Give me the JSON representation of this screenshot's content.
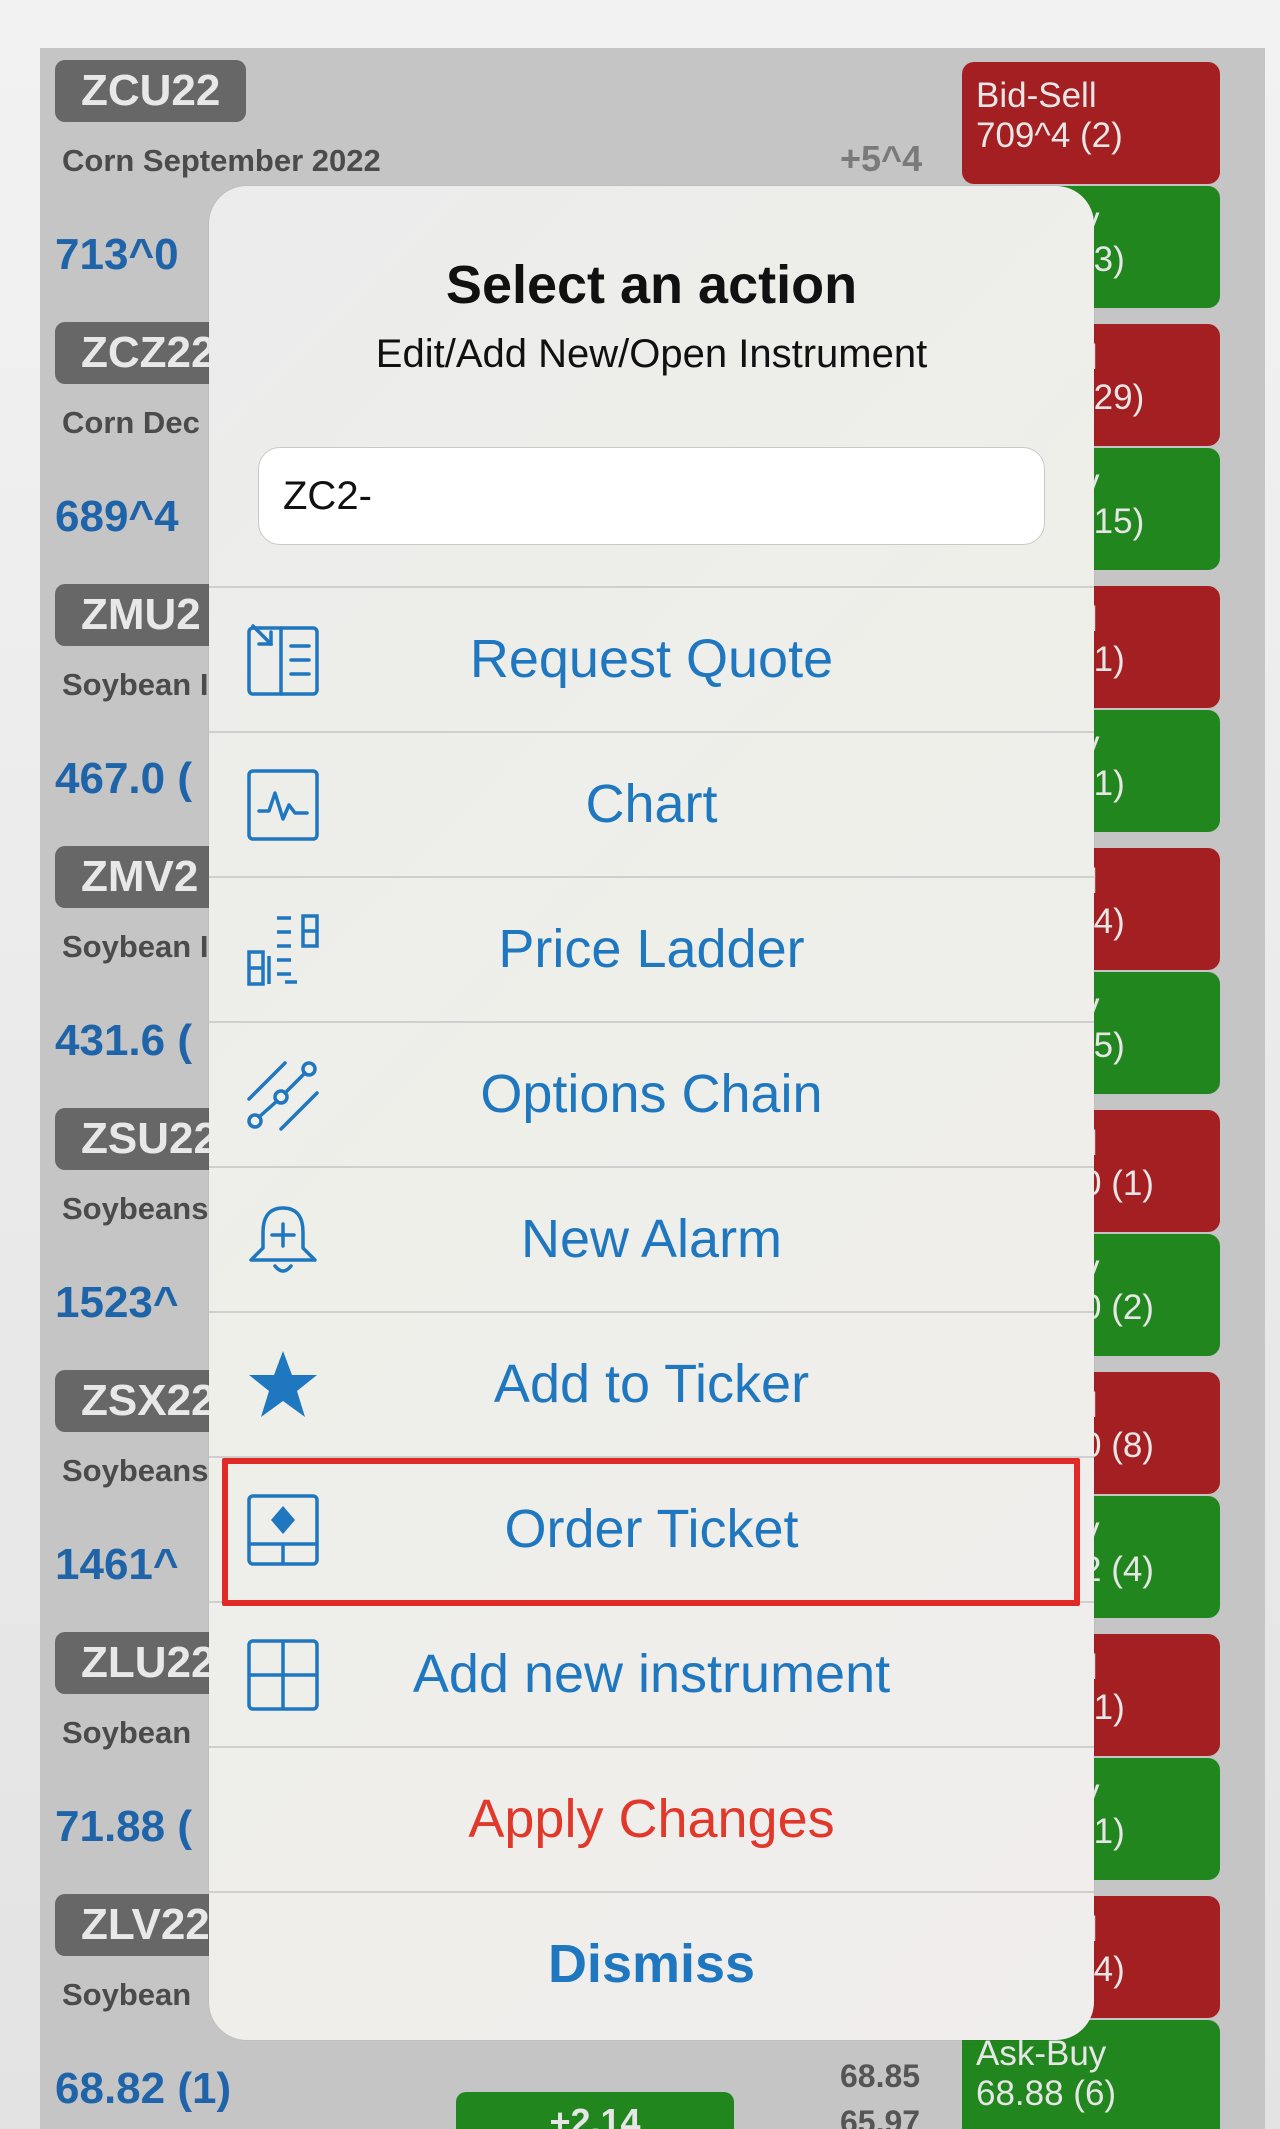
{
  "rows": [
    {
      "symbol": "ZCU22",
      "desc": "Corn  September 2022",
      "change": "+5^4",
      "last": "713^0",
      "sell": "Bid-Sell",
      "sell_val": "709^4 (2)",
      "buy": "y",
      "buy_val": "(3)"
    },
    {
      "symbol": "ZCZ22",
      "desc": "Corn  Dec",
      "last": "689^4",
      "sell": "ll",
      "sell_val": "(29)",
      "buy": "y",
      "buy_val": "(15)"
    },
    {
      "symbol": "ZMU2",
      "desc": "Soybean I",
      "last": "467.0 (",
      "sell": "ll",
      "sell_val": "(1)",
      "buy": "y",
      "buy_val": "(1)"
    },
    {
      "symbol": "ZMV2",
      "desc": "Soybean I",
      "last": "431.6 (",
      "sell": "ll",
      "sell_val": "(4)",
      "buy": "y",
      "buy_val": "(5)"
    },
    {
      "symbol": "ZSU22",
      "desc": "Soybeans",
      "last": "1523^",
      "sell": "ll",
      "sell_val": "0 (1)",
      "buy": "y",
      "buy_val": "0 (2)"
    },
    {
      "symbol": "ZSX22",
      "desc": "Soybeans",
      "last": "1461^",
      "sell": "ll",
      "sell_val": "0 (8)",
      "buy": "y",
      "buy_val": "2 (4)"
    },
    {
      "symbol": "ZLU22",
      "desc": "Soybean",
      "last": "71.88 (",
      "sell": "ll",
      "sell_val": "(1)",
      "buy": "y",
      "buy_val": "(1)"
    },
    {
      "symbol": "ZLV22",
      "desc": "Soybean",
      "last": "68.82 (1)",
      "sell": "ll",
      "sell_val": "(4)",
      "buy": "Ask-Buy",
      "buy_val": "68.88 (6)",
      "change_pill": "+2.14",
      "high": "68.85",
      "low": "65.97"
    }
  ],
  "modal": {
    "title": "Select an action",
    "subtitle": "Edit/Add New/Open Instrument",
    "input_value": "ZC2-",
    "actions": [
      {
        "label": "Request Quote",
        "icon": "request-quote-icon"
      },
      {
        "label": "Chart",
        "icon": "chart-icon"
      },
      {
        "label": "Price Ladder",
        "icon": "price-ladder-icon"
      },
      {
        "label": "Options Chain",
        "icon": "options-chain-icon"
      },
      {
        "label": "New Alarm",
        "icon": "bell-plus-icon"
      },
      {
        "label": "Add to Ticker",
        "icon": "star-icon"
      },
      {
        "label": "Order Ticket",
        "icon": "order-ticket-icon"
      },
      {
        "label": "Add new instrument",
        "icon": "plus-box-icon"
      },
      {
        "label": "Apply Changes"
      },
      {
        "label": "Dismiss"
      }
    ]
  },
  "colors": {
    "accent": "#1f77bf",
    "destructive": "#e0392c",
    "sell": "#a41f22",
    "buy": "#22861f",
    "highlight": "#e02a25"
  }
}
